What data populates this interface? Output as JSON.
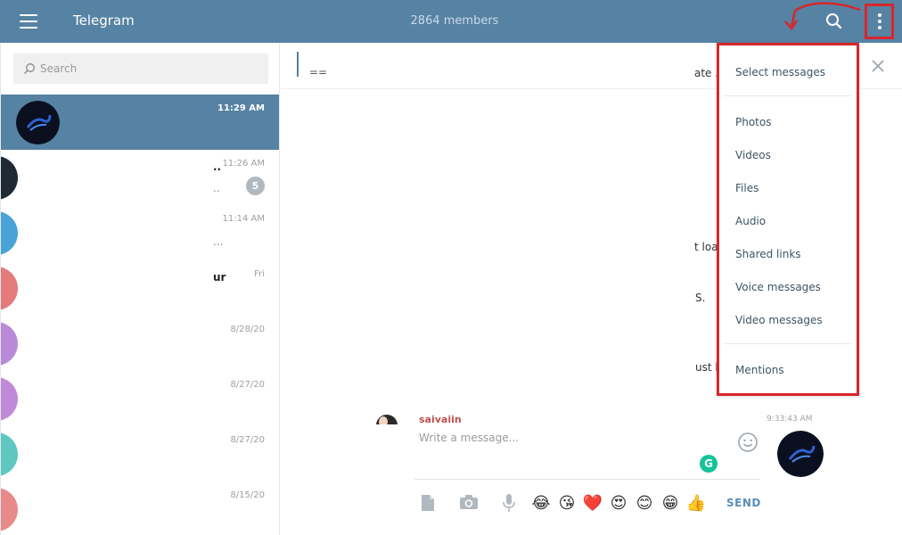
{
  "header": {
    "app_title": "Telegram",
    "members": "2864 members"
  },
  "search": {
    "placeholder": "Search"
  },
  "chats": [
    {
      "time": "11:29 AM",
      "snippet": "",
      "unread": "",
      "active": true
    },
    {
      "time": "11:26 AM",
      "snippet": "..",
      "snippet2": "..",
      "unread": "5"
    },
    {
      "time": "11:14 AM",
      "snippet": "",
      "snippet2": "..."
    },
    {
      "time": "Fri",
      "snippet": "ur"
    },
    {
      "time": "8/28/20"
    },
    {
      "time": "8/27/20"
    },
    {
      "time": "8/27/20"
    },
    {
      "time": "8/15/20"
    }
  ],
  "main": {
    "pinned_text": "==",
    "fragments": [
      "ate ...",
      "t loa",
      "S.",
      "ust l"
    ],
    "message_author": "saiyajin",
    "message_time": "9:33:43 AM"
  },
  "composer": {
    "placeholder": "Write a message...",
    "send_label": "SEND",
    "grammarly": "G"
  },
  "emojis": [
    "😂",
    "😘",
    "❤️",
    "😍",
    "😊",
    "😁",
    "👍"
  ],
  "menu": {
    "items": [
      "Select messages",
      "Photos",
      "Videos",
      "Files",
      "Audio",
      "Shared links",
      "Voice messages",
      "Video messages",
      "Mentions"
    ]
  },
  "colors": {
    "header": "#5682a3",
    "highlight": "#d7262c",
    "menu_text": "#3d5466",
    "send": "#5b8db8"
  }
}
